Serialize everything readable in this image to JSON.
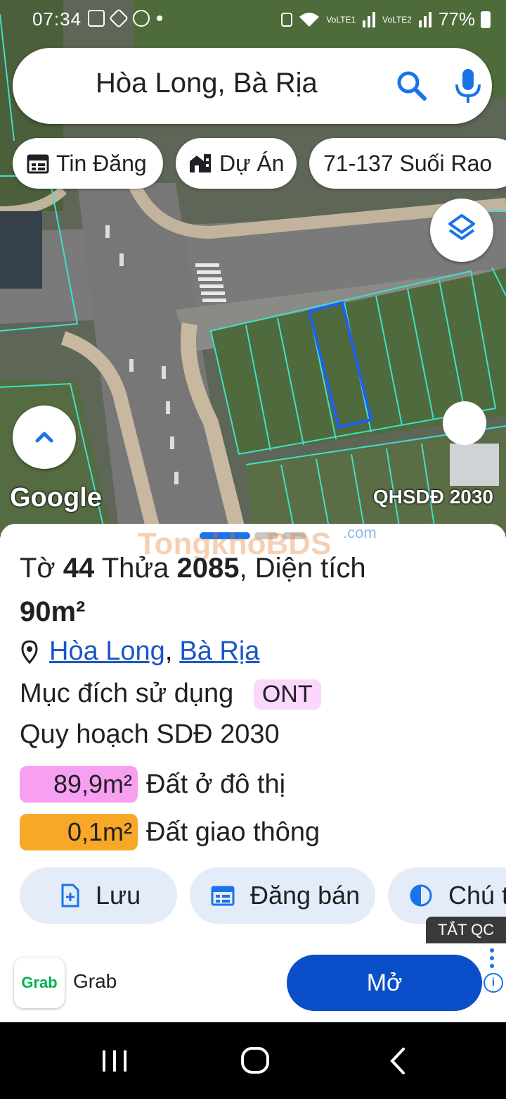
{
  "status_bar": {
    "time": "07:34",
    "battery": "77%",
    "sim1": "VoLTE1",
    "sim2": "VoLTE2"
  },
  "search": {
    "query": "Hòa Long, Bà Rịa",
    "icon_search": "search-icon",
    "icon_mic": "mic-icon"
  },
  "chips": [
    {
      "label": "Tin Đăng",
      "icon": "calendar-icon"
    },
    {
      "label": "Dự Án",
      "icon": "buildings-icon"
    },
    {
      "label": "71-137 Suối Rao",
      "icon": ""
    }
  ],
  "map": {
    "brand": "Google",
    "layer_tag": "QHSDĐ 2030",
    "parcel_outline_color": "#1f5ff0",
    "lot_line_color": "#3fe0c8"
  },
  "sheet": {
    "watermark": "TongkhoBDS",
    "watermark_suffix": ".com",
    "title_prefix": "Tờ",
    "sheet_no": "44",
    "plot_prefix": "Thửa",
    "plot_no": "2085",
    "area_prefix": ", Diện tích",
    "area": "90m²",
    "location": {
      "ward": "Hòa Long",
      "separator": ",",
      "city": "Bà Rịa"
    },
    "purpose_label": "Mục đích sử dụng",
    "purpose_code": "ONT",
    "plan_label": "Quy hoạch SDĐ 2030",
    "land_uses": [
      {
        "area": "89,9m²",
        "name": "Đất ở đô thị",
        "color": "#f7a0f2"
      },
      {
        "area": "0,1m²",
        "name": "Đất giao thông",
        "color": "#f7a826"
      }
    ],
    "actions": [
      {
        "label": "Lưu",
        "icon": "add-file-icon"
      },
      {
        "label": "Đăng bán",
        "icon": "calendar-icon"
      },
      {
        "label": "Chú t",
        "icon": "contrast-icon"
      }
    ]
  },
  "ad": {
    "close_label": "TẮT QC",
    "brand": "Grab",
    "logo_text": "Grab",
    "cta": "Mở",
    "info": "i",
    "brand_color": "#00b14f",
    "cta_color": "#0a4fc9"
  },
  "nav": {
    "recent": "recent-apps-icon",
    "home": "home-icon",
    "back": "back-icon"
  }
}
